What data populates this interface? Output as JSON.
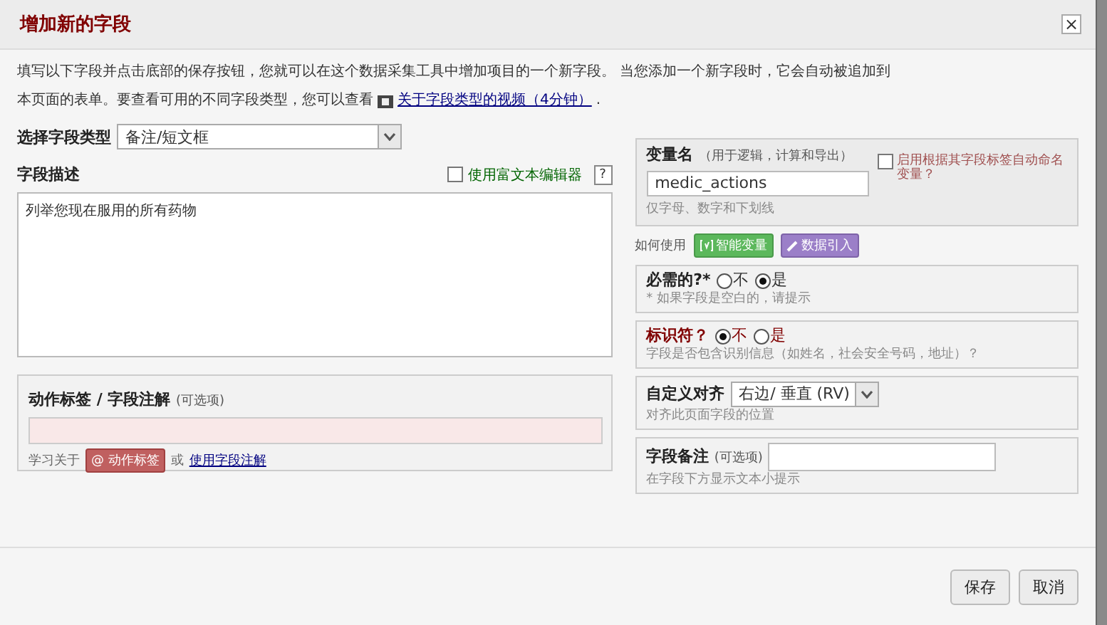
{
  "dialog": {
    "title": "增加新的字段",
    "close": "×"
  },
  "intro": {
    "line_1": "填写以下字段并点击底部的保存按钮，您就可以在这个数据采集工具中增加项目的一个新字段。 当您添加一个新字段时，它会自动被追加到",
    "line_2": "本页面的表单。要查看可用的不同字段类型，您可以查看",
    "link": "关于字段类型的视频（4分钟）",
    "end": "."
  },
  "field_type": {
    "label": "选择字段类型",
    "value": "备注/短文框"
  },
  "description": {
    "label": "字段描述",
    "rich_text": {
      "label": "使用富文本编辑器",
      "checked": false
    },
    "help": "?",
    "value": "列举您现在服用的所有药物"
  },
  "action_tags": {
    "label": "动作标签 / 字段注解",
    "optional": "(可选项)",
    "learn": "学习关于",
    "tag_button": "@ 动作标签",
    "or": "或",
    "link": "使用字段注解"
  },
  "variable": {
    "label": "变量名",
    "hint": "（用于逻辑，计算和导出）",
    "value": "medic_actions",
    "note": "仅字母、数字和下划线",
    "auto": {
      "label": "启用根据其字段标签自动命名变量？",
      "checked": false
    }
  },
  "how_to_use": {
    "label": "如何使用",
    "buttons": [
      {
        "kind": "smart",
        "label": "智能变量"
      },
      {
        "kind": "pipe",
        "label": "数据引入"
      }
    ]
  },
  "required": {
    "label": "必需的?*",
    "options": [
      {
        "label": "不",
        "selected": false
      },
      {
        "label": "是",
        "selected": true
      }
    ],
    "note": "* 如果字段是空白的，请提示"
  },
  "identifier": {
    "label": "标识符？",
    "options": [
      {
        "label": "不",
        "selected": true
      },
      {
        "label": "是",
        "selected": false
      }
    ],
    "note": "字段是否包含识别信息（如姓名，社会安全号码，地址）？"
  },
  "align": {
    "label": "自定义对齐",
    "value": "右边/ 垂直 (RV)",
    "note": "对齐此页面字段的位置"
  },
  "field_note": {
    "label": "字段备注",
    "optional": "(可选项)",
    "note": "在字段下方显示文本小提示"
  },
  "buttons": [
    "保存",
    "取消"
  ]
}
